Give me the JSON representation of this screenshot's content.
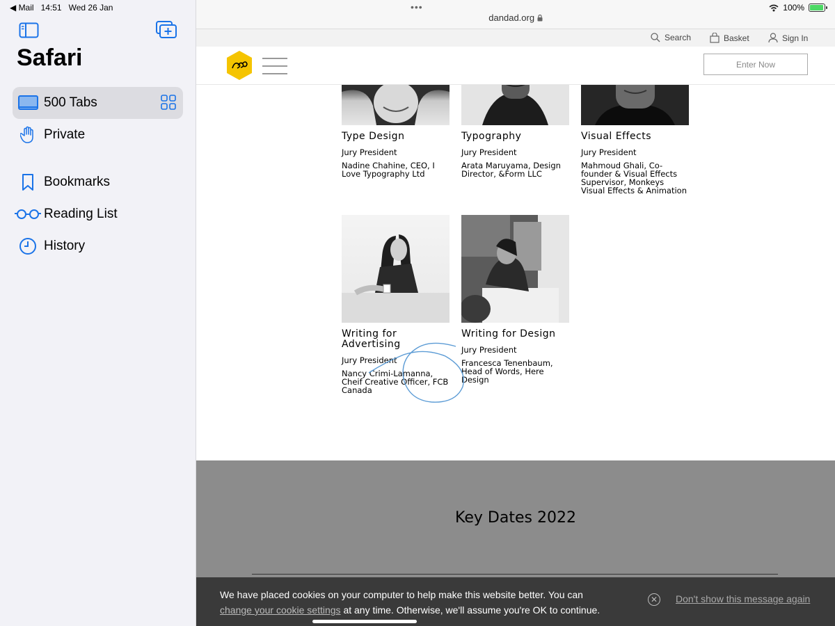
{
  "status_bar": {
    "back_app": "◀ Mail",
    "time": "14:51",
    "date": "Wed 26 Jan",
    "battery": "100%",
    "battery_level": 1.0
  },
  "sidebar": {
    "title": "Safari",
    "items": [
      {
        "label": "500 Tabs",
        "icon": "tabs-icon",
        "selected": true
      },
      {
        "label": "Private",
        "icon": "hand-icon"
      },
      {
        "label": "Bookmarks",
        "icon": "bookmark-icon"
      },
      {
        "label": "Reading List",
        "icon": "glasses-icon"
      },
      {
        "label": "History",
        "icon": "clock-icon"
      }
    ]
  },
  "browser": {
    "url": "dandad.org"
  },
  "utility_nav": {
    "search": "Search",
    "basket": "Basket",
    "sign_in": "Sign In"
  },
  "header": {
    "enter_now": "Enter Now"
  },
  "cards": [
    {
      "title": "Type Design",
      "role": "Jury President",
      "desc": "Nadine Chahine, CEO, I Love Typography Ltd"
    },
    {
      "title": "Typography",
      "role": "Jury President",
      "desc": "Arata Maruyama, Design Director, &Form LLC"
    },
    {
      "title": "Visual Effects",
      "role": "Jury President",
      "desc": "Mahmoud Ghali, Co-founder & Visual Effects Supervisor, Monkeys Visual Effects & Animation"
    },
    {
      "title": "Writing for Advertising",
      "role": "Jury President",
      "desc": "Nancy Crimi-Lamanna, Cheif Creative Officer, FCB Canada"
    },
    {
      "title": "Writing for Design",
      "role": "Jury President",
      "desc": "Francesca Tenenbaum, Head of Words, Here Design"
    }
  ],
  "key_dates": {
    "title": "Key Dates 2022"
  },
  "cookie": {
    "text_before": "We have placed cookies on your computer to help make this website better. You can",
    "link": "change your cookie settings",
    "text_after": "at any time. Otherwise, we'll assume you're OK to continue.",
    "dismiss": "Don't show this message again"
  },
  "colors": {
    "accent": "#1a73e8",
    "logo_yellow": "#f5c400",
    "keydates_bg": "#8c8c8c",
    "cookie_bg": "#3a3a3a"
  }
}
